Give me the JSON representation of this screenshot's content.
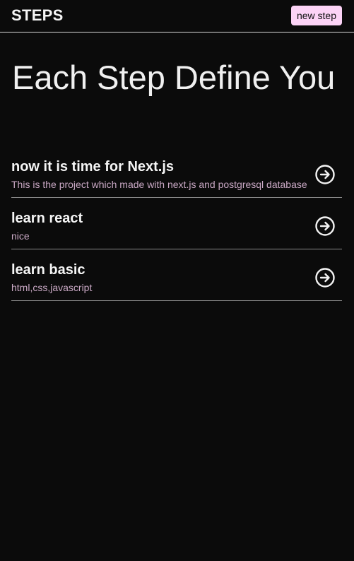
{
  "header": {
    "brand": "STEPS",
    "new_step_label": "new step"
  },
  "hero": {
    "title": "Each Step Define You"
  },
  "steps": [
    {
      "title": "now it is time for Next.js",
      "description": "This is the project which made with next.js and postgresql database",
      "icon": "arrow-right-circle-icon"
    },
    {
      "title": "learn react",
      "description": "nice",
      "icon": "arrow-right-circle-icon"
    },
    {
      "title": "learn basic",
      "description": "html,css,javascript",
      "icon": "arrow-right-circle-icon"
    }
  ],
  "colors": {
    "background": "#0b0b0b",
    "accent_button": "#fcd3f6",
    "description_text": "#c9a8c4",
    "divider": "#8a8a8a"
  }
}
